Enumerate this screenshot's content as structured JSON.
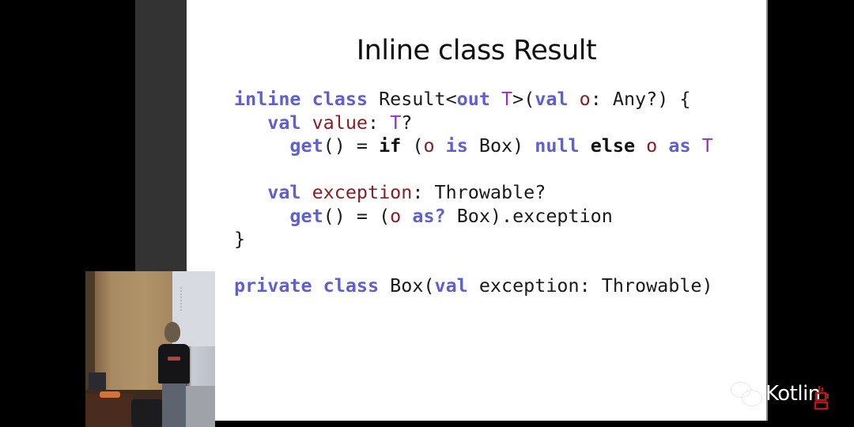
{
  "slide": {
    "title": "Inline class Result",
    "code_lines": [
      [
        {
          "t": "inline class",
          "c": "kw"
        },
        {
          "t": " Result<",
          "c": ""
        },
        {
          "t": "out",
          "c": "kw"
        },
        {
          "t": " ",
          "c": ""
        },
        {
          "t": "T",
          "c": "tp"
        },
        {
          "t": ">(",
          "c": ""
        },
        {
          "t": "val",
          "c": "kw"
        },
        {
          "t": " ",
          "c": ""
        },
        {
          "t": "o",
          "c": "id"
        },
        {
          "t": ": Any?) {",
          "c": ""
        }
      ],
      [
        {
          "t": "   ",
          "c": ""
        },
        {
          "t": "val",
          "c": "kw"
        },
        {
          "t": " ",
          "c": ""
        },
        {
          "t": "value",
          "c": "id"
        },
        {
          "t": ": ",
          "c": ""
        },
        {
          "t": "T",
          "c": "tp"
        },
        {
          "t": "?",
          "c": ""
        }
      ],
      [
        {
          "t": "     ",
          "c": ""
        },
        {
          "t": "get",
          "c": "kw"
        },
        {
          "t": "() = ",
          "c": ""
        },
        {
          "t": "if",
          "c": "bk"
        },
        {
          "t": " (",
          "c": ""
        },
        {
          "t": "o",
          "c": "id"
        },
        {
          "t": " ",
          "c": ""
        },
        {
          "t": "is",
          "c": "kw"
        },
        {
          "t": " Box) ",
          "c": ""
        },
        {
          "t": "null",
          "c": "kw"
        },
        {
          "t": " ",
          "c": ""
        },
        {
          "t": "else",
          "c": "bk"
        },
        {
          "t": " ",
          "c": ""
        },
        {
          "t": "o",
          "c": "id"
        },
        {
          "t": " ",
          "c": ""
        },
        {
          "t": "as",
          "c": "kw"
        },
        {
          "t": " ",
          "c": ""
        },
        {
          "t": "T",
          "c": "tp"
        }
      ],
      [],
      [
        {
          "t": "   ",
          "c": ""
        },
        {
          "t": "val",
          "c": "kw"
        },
        {
          "t": " ",
          "c": ""
        },
        {
          "t": "exception",
          "c": "id"
        },
        {
          "t": ": Throwable?",
          "c": ""
        }
      ],
      [
        {
          "t": "     ",
          "c": ""
        },
        {
          "t": "get",
          "c": "kw"
        },
        {
          "t": "() = (",
          "c": ""
        },
        {
          "t": "o",
          "c": "id"
        },
        {
          "t": " ",
          "c": ""
        },
        {
          "t": "as?",
          "c": "kw"
        },
        {
          "t": " Box).exception",
          "c": ""
        }
      ],
      [
        {
          "t": "}",
          "c": ""
        }
      ],
      [],
      [
        {
          "t": "private class",
          "c": "kw"
        },
        {
          "t": " Box(",
          "c": ""
        },
        {
          "t": "val",
          "c": "kw"
        },
        {
          "t": " exception: Throwable)",
          "c": ""
        }
      ]
    ]
  },
  "colors": {
    "keyword": "#5f5fd0",
    "identifier": "#8b1e24",
    "type_param": "#9a2fc8"
  },
  "watermark": {
    "icon": "wechat-icon",
    "text": "Kotlin",
    "logo_icon": "coffee-cup-icon"
  },
  "video_inset": {
    "description": "speaker-camera-feed"
  }
}
